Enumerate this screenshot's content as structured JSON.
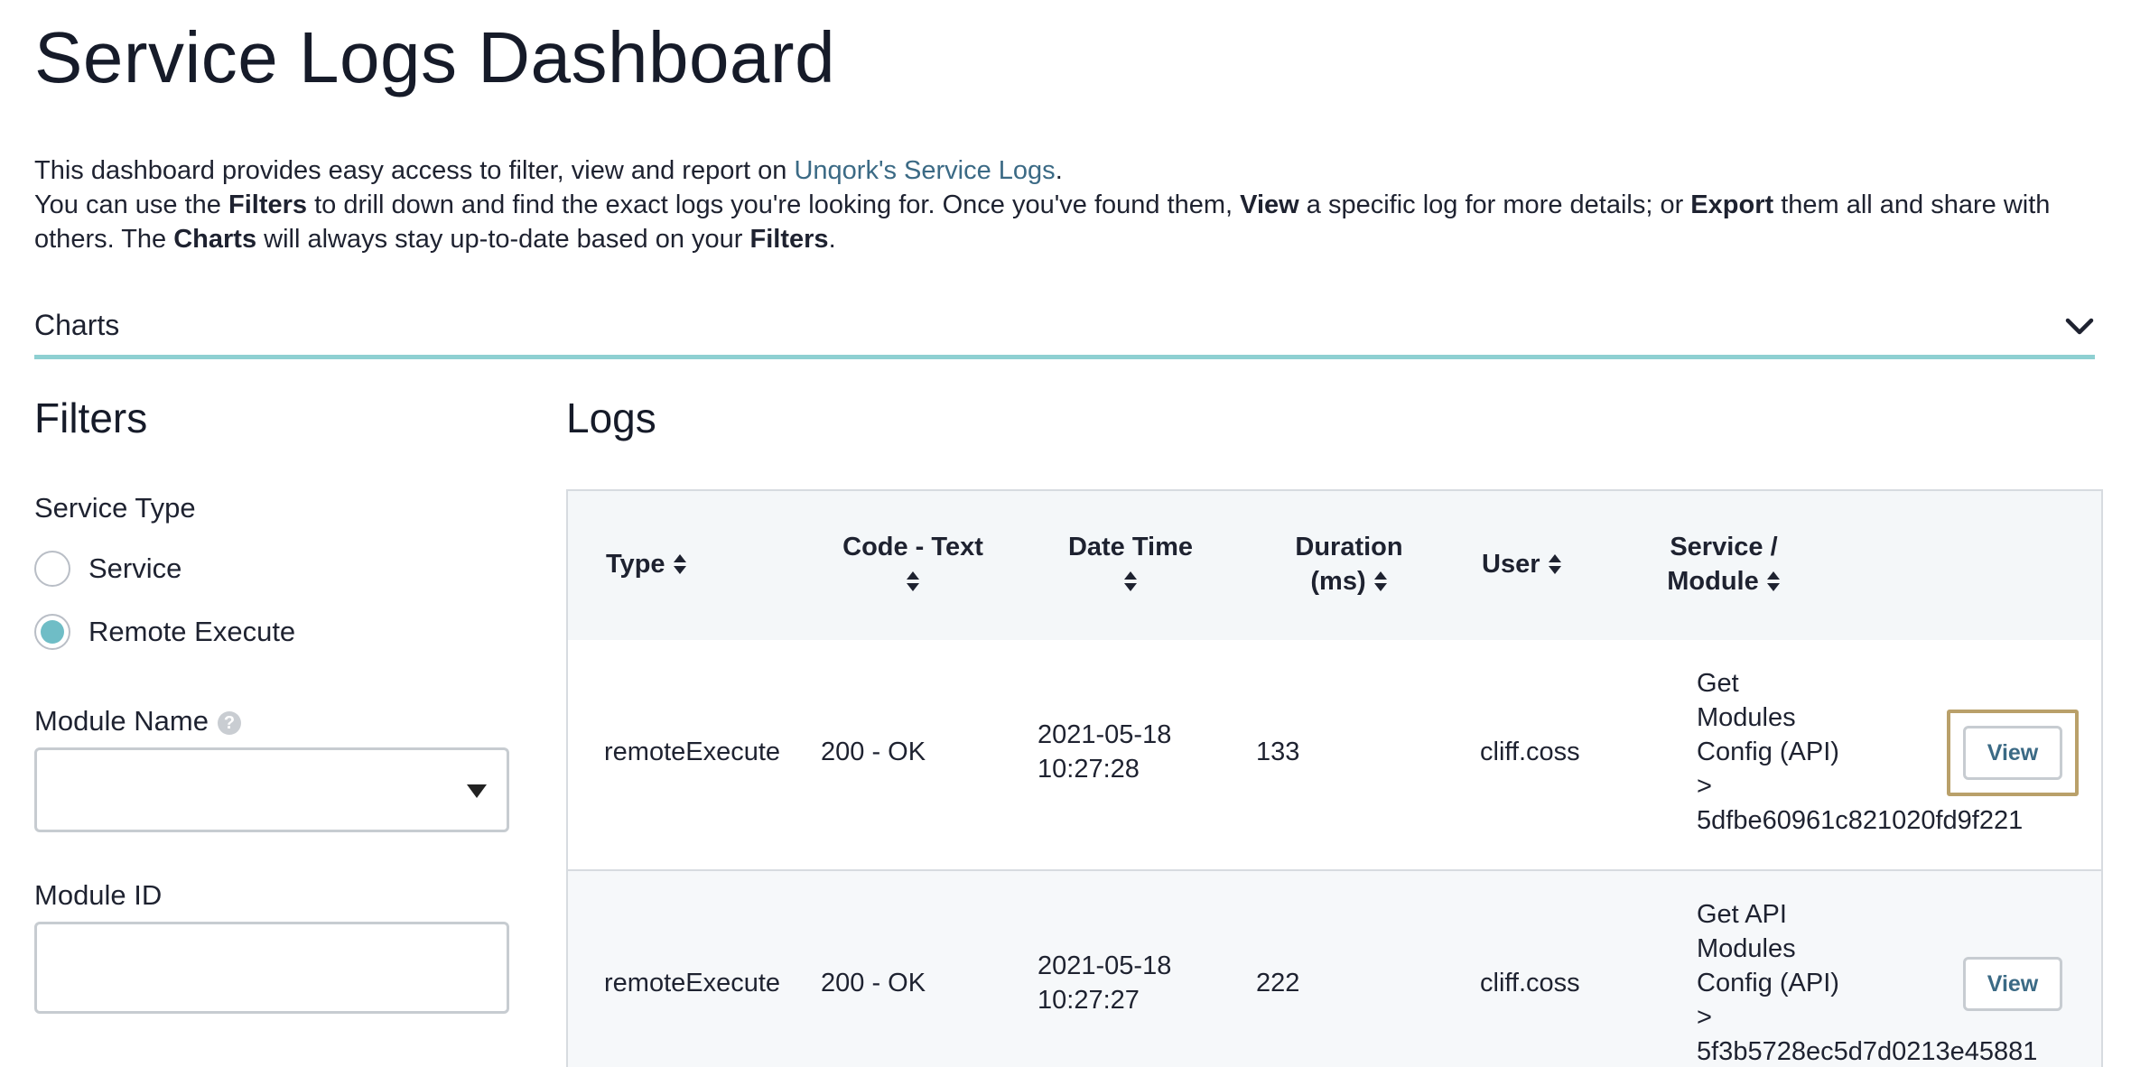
{
  "page": {
    "title": "Service Logs Dashboard"
  },
  "intro": {
    "line1_pre": "This dashboard provides easy access to filter, view and report on ",
    "line1_link": "Unqork's Service Logs",
    "line1_post": ".",
    "line2_a": "You can use the ",
    "line2_filters": "Filters",
    "line2_b": " to drill down and find the exact logs you're looking for. Once you've found them, ",
    "line2_view": "View",
    "line2_c": " a specific log for more details; or ",
    "line2_export": "Export",
    "line2_d": " them all and share with others. The ",
    "line2_charts": "Charts",
    "line2_e": " will always stay up-to-date based on your ",
    "line2_filters2": "Filters",
    "line2_f": "."
  },
  "charts_panel": {
    "label": "Charts",
    "toggle_icon": "chevron-down-icon"
  },
  "filters": {
    "title": "Filters",
    "service_type": {
      "label": "Service Type",
      "options": [
        {
          "label": "Service",
          "checked": false
        },
        {
          "label": "Remote Execute",
          "checked": true
        }
      ]
    },
    "module_name": {
      "label": "Module Name",
      "help_icon": "?",
      "value": ""
    },
    "module_id": {
      "label": "Module ID",
      "value": ""
    }
  },
  "logs": {
    "title": "Logs",
    "columns": [
      {
        "line1": "Type",
        "line2": ""
      },
      {
        "line1": "Code - Text",
        "line2": ""
      },
      {
        "line1": "Date Time",
        "line2": ""
      },
      {
        "line1": "Duration",
        "line2": "(ms)"
      },
      {
        "line1": "User",
        "line2": ""
      },
      {
        "line1": "Service /",
        "line2": "Module"
      }
    ],
    "rows": [
      {
        "type": "remoteExecute",
        "code": "200 - OK",
        "date": "2021-05-18",
        "time": "10:27:28",
        "duration": "133",
        "user": "cliff.coss",
        "service": [
          "Get",
          "Modules",
          "Config (API)",
          ">",
          "5dfbe60961c821020fd9f221"
        ],
        "action": "View"
      },
      {
        "type": "remoteExecute",
        "code": "200 - OK",
        "date": "2021-05-18",
        "time": "10:27:27",
        "duration": "222",
        "user": "cliff.coss",
        "service": [
          "Get API",
          "Modules",
          "Config (API)",
          ">",
          "5f3b5728ec5d7d0213e45881"
        ],
        "action": "View"
      }
    ]
  },
  "colors": {
    "accent_teal": "#8ed0d2",
    "radio_fill": "#6fbdc6",
    "link": "#3b6a85",
    "focus_ring": "#b9a06a"
  }
}
